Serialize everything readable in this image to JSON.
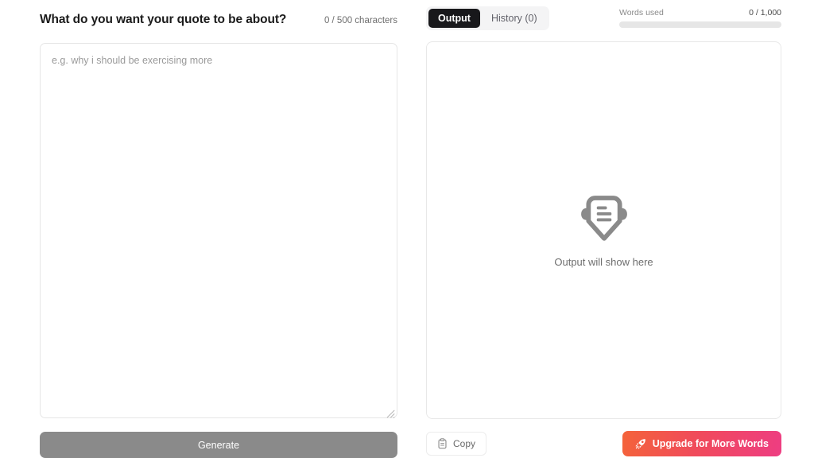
{
  "colors": {
    "accent_gradient_start": "#f4633a",
    "accent_gradient_end": "#ee3d82",
    "active_tab_bg": "#18181b",
    "generate_disabled_bg": "#8a8a8a",
    "border": "#e8e8e8",
    "muted_text": "#6e6e6e",
    "progress_track": "#e6e6e6"
  },
  "left": {
    "prompt_title": "What do you want your quote to be about?",
    "char_counter": "0 / 500 characters",
    "textarea_value": "",
    "textarea_placeholder": "e.g. why i should be exercising more",
    "generate_label": "Generate",
    "resize_grip_icon": "resize-grip-icon"
  },
  "right": {
    "tabs": [
      {
        "label": "Output",
        "active": true
      },
      {
        "label": "History (0)",
        "active": false
      }
    ],
    "words_meter": {
      "label": "Words used",
      "value": "0 / 1,000",
      "percent": 0
    },
    "output_panel": {
      "empty_icon": "output-badge-icon",
      "empty_text": "Output will show here"
    },
    "actions": {
      "copy_label": "Copy",
      "copy_icon": "clipboard-icon",
      "upgrade_label": "Upgrade for More Words",
      "upgrade_icon": "rocket-icon"
    }
  }
}
